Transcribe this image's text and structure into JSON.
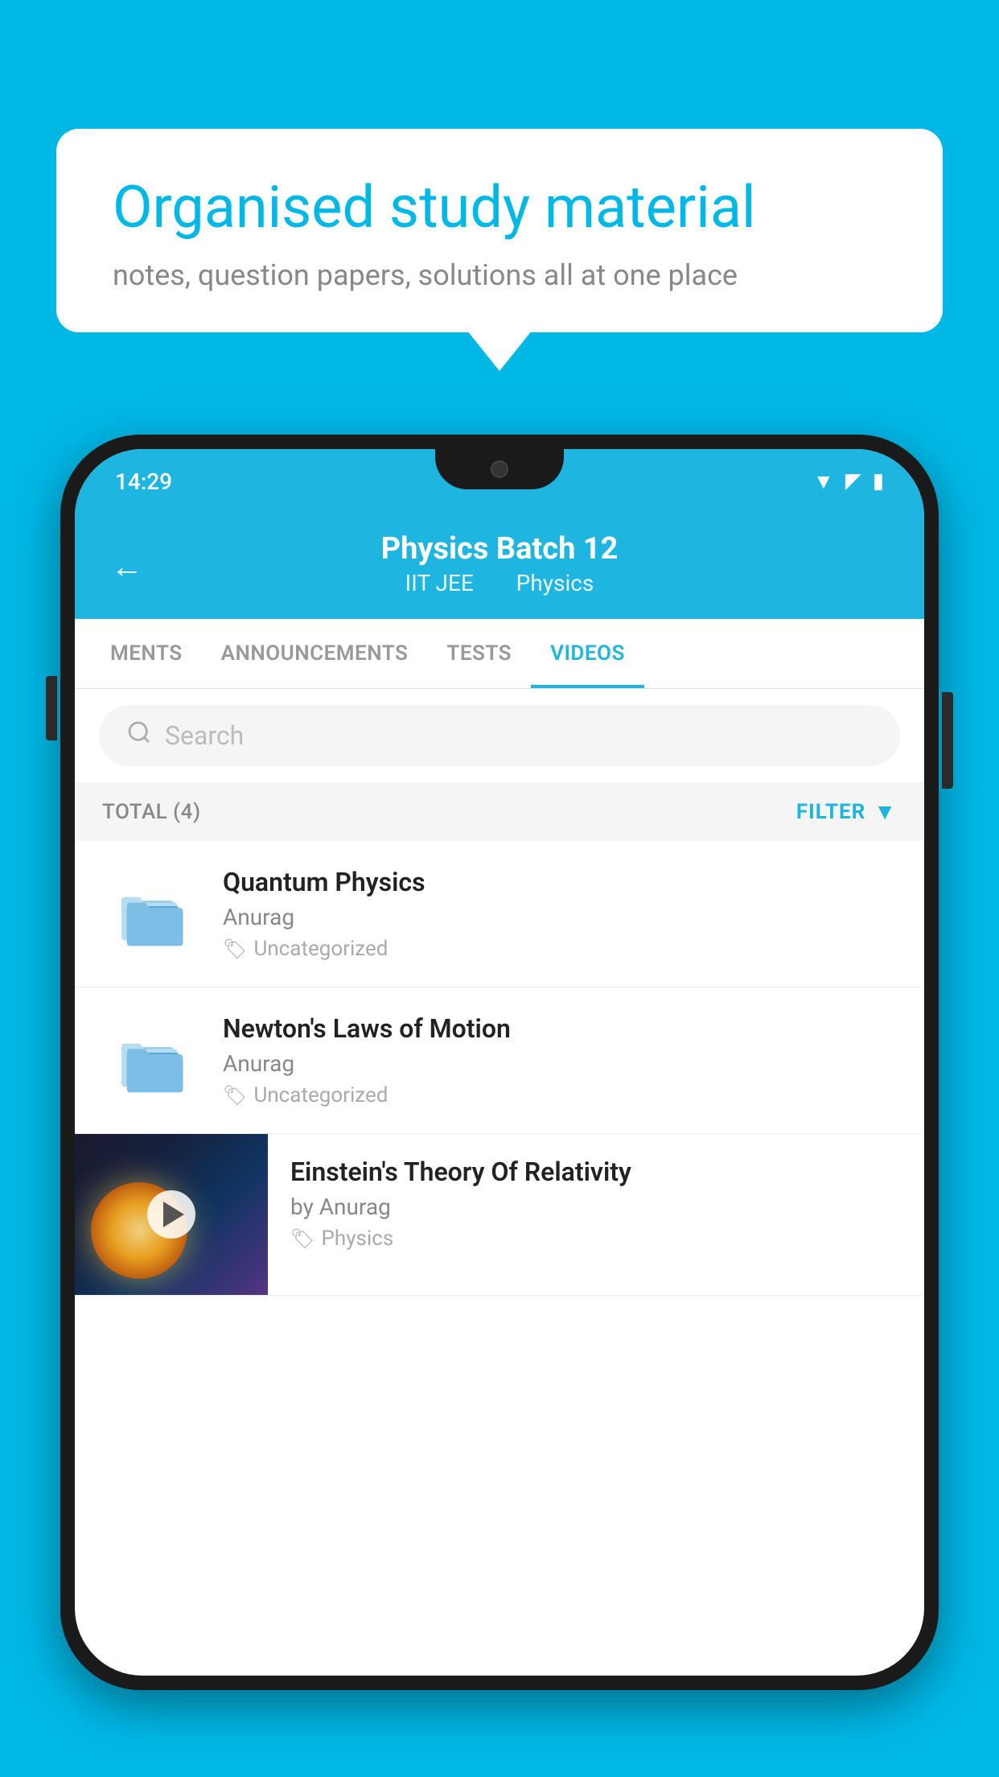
{
  "background_color": "#00b8e6",
  "speech_bubble": {
    "title": "Organised study material",
    "subtitle": "notes, question papers, solutions all at one place"
  },
  "phone": {
    "status_bar": {
      "time": "14:29",
      "wifi": "▲",
      "signal": "▲",
      "battery": "▮"
    },
    "header": {
      "back_label": "←",
      "title": "Physics Batch 12",
      "subtitle_part1": "IIT JEE",
      "subtitle_part2": "Physics"
    },
    "tabs": [
      {
        "label": "MENTS",
        "active": false
      },
      {
        "label": "ANNOUNCEMENTS",
        "active": false
      },
      {
        "label": "TESTS",
        "active": false
      },
      {
        "label": "VIDEOS",
        "active": true
      }
    ],
    "search": {
      "placeholder": "Search"
    },
    "filter": {
      "total_label": "TOTAL (4)",
      "filter_label": "FILTER"
    },
    "videos": [
      {
        "id": 1,
        "title": "Quantum Physics",
        "author": "Anurag",
        "tag": "Uncategorized",
        "type": "folder"
      },
      {
        "id": 2,
        "title": "Newton's Laws of Motion",
        "author": "Anurag",
        "tag": "Uncategorized",
        "type": "folder"
      },
      {
        "id": 3,
        "title": "Einstein's Theory Of Relativity",
        "author": "by Anurag",
        "tag": "Physics",
        "type": "video"
      }
    ]
  }
}
